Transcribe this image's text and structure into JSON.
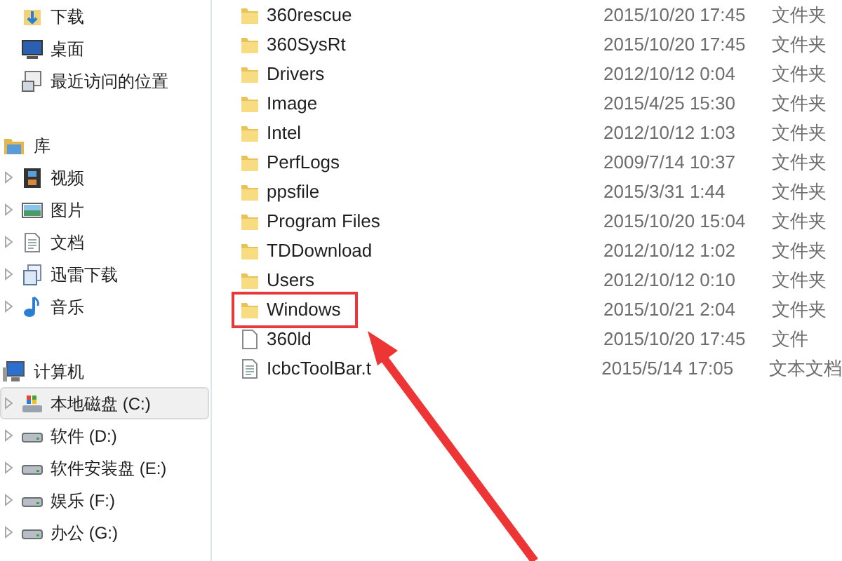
{
  "sidebar": {
    "groups": [
      {
        "items": [
          {
            "label": "下载",
            "kind": "download",
            "expandable": false,
            "selected": false
          },
          {
            "label": "桌面",
            "kind": "desktop",
            "expandable": false,
            "selected": false
          },
          {
            "label": "最近访问的位置",
            "kind": "recent",
            "expandable": false,
            "selected": false
          }
        ]
      },
      {
        "header": {
          "label": "库",
          "kind": "library"
        },
        "items": [
          {
            "label": "视频",
            "kind": "video",
            "expandable": true,
            "selected": false
          },
          {
            "label": "图片",
            "kind": "picture",
            "expandable": true,
            "selected": false
          },
          {
            "label": "文档",
            "kind": "document",
            "expandable": true,
            "selected": false
          },
          {
            "label": "迅雷下载",
            "kind": "download-folder",
            "expandable": true,
            "selected": false
          },
          {
            "label": "音乐",
            "kind": "music",
            "expandable": true,
            "selected": false
          }
        ]
      },
      {
        "header": {
          "label": "计算机",
          "kind": "computer"
        },
        "items": [
          {
            "label": "本地磁盘 (C:)",
            "kind": "system-drive",
            "expandable": true,
            "selected": true
          },
          {
            "label": "软件 (D:)",
            "kind": "drive",
            "expandable": true,
            "selected": false
          },
          {
            "label": "软件安装盘 (E:)",
            "kind": "drive",
            "expandable": true,
            "selected": false
          },
          {
            "label": "娱乐 (F:)",
            "kind": "drive",
            "expandable": true,
            "selected": false
          },
          {
            "label": "办公 (G:)",
            "kind": "drive",
            "expandable": true,
            "selected": false
          }
        ]
      }
    ]
  },
  "files": [
    {
      "name": "360rescue",
      "date": "2015/10/20 17:45",
      "type": "文件夹",
      "kind": "folder",
      "highlighted": false
    },
    {
      "name": "360SysRt",
      "date": "2015/10/20 17:45",
      "type": "文件夹",
      "kind": "folder",
      "highlighted": false
    },
    {
      "name": "Drivers",
      "date": "2012/10/12 0:04",
      "type": "文件夹",
      "kind": "folder",
      "highlighted": false
    },
    {
      "name": "Image",
      "date": "2015/4/25 15:30",
      "type": "文件夹",
      "kind": "folder",
      "highlighted": false
    },
    {
      "name": "Intel",
      "date": "2012/10/12 1:03",
      "type": "文件夹",
      "kind": "folder",
      "highlighted": false
    },
    {
      "name": "PerfLogs",
      "date": "2009/7/14 10:37",
      "type": "文件夹",
      "kind": "folder",
      "highlighted": false
    },
    {
      "name": "ppsfile",
      "date": "2015/3/31 1:44",
      "type": "文件夹",
      "kind": "folder",
      "highlighted": false
    },
    {
      "name": "Program Files",
      "date": "2015/10/20 15:04",
      "type": "文件夹",
      "kind": "folder",
      "highlighted": false
    },
    {
      "name": "TDDownload",
      "date": "2012/10/12 1:02",
      "type": "文件夹",
      "kind": "folder",
      "highlighted": false
    },
    {
      "name": "Users",
      "date": "2012/10/12 0:10",
      "type": "文件夹",
      "kind": "folder",
      "highlighted": false
    },
    {
      "name": "Windows",
      "date": "2015/10/21 2:04",
      "type": "文件夹",
      "kind": "folder",
      "highlighted": true
    },
    {
      "name": "360ld",
      "date": "2015/10/20 17:45",
      "type": "文件",
      "kind": "file",
      "highlighted": false
    },
    {
      "name": "IcbcToolBar.t",
      "date": "2015/5/14 17:05",
      "type": "文本文档",
      "kind": "text",
      "highlighted": false
    }
  ]
}
